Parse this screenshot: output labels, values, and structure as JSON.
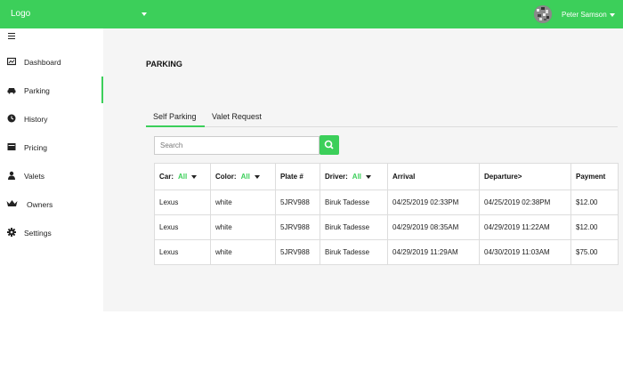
{
  "header": {
    "logo": "Logo",
    "user_name": "Peter Samson"
  },
  "sidebar": {
    "items": [
      {
        "label": "Dashboard",
        "icon": "dashboard-icon"
      },
      {
        "label": "Parking",
        "icon": "car-icon",
        "active": true
      },
      {
        "label": "History",
        "icon": "clock-icon"
      },
      {
        "label": "Pricing",
        "icon": "pricing-icon"
      },
      {
        "label": "Valets",
        "icon": "user-icon"
      },
      {
        "label": "Owners",
        "icon": "crown-icon"
      },
      {
        "label": "Settings",
        "icon": "gear-icon"
      }
    ]
  },
  "main": {
    "title": "PARKING",
    "tabs": [
      {
        "label": "Self Parking",
        "active": true
      },
      {
        "label": "Valet Request"
      }
    ],
    "search": {
      "placeholder": "Search",
      "value": ""
    }
  },
  "table": {
    "headers": {
      "car_label": "Car:",
      "car_filter": "All",
      "color_label": "Color:",
      "color_filter": "All",
      "plate": "Plate #",
      "driver_label": "Driver:",
      "driver_filter": "All",
      "arrival": "Arrival",
      "departure": "Departure>",
      "payment": "Payment"
    },
    "rows": [
      {
        "car": "Lexus",
        "color": "white",
        "plate": "5JRV988",
        "driver": "Biruk Tadesse",
        "arrival": "04/25/2019 02:33PM",
        "departure": "04/25/2019 02:38PM",
        "payment": "$12.00"
      },
      {
        "car": "Lexus",
        "color": "white",
        "plate": "5JRV988",
        "driver": "Biruk Tadesse",
        "arrival": "04/29/2019 08:35AM",
        "departure": "04/29/2019 11:22AM",
        "payment": "$12.00"
      },
      {
        "car": "Lexus",
        "color": "white",
        "plate": "5JRV988",
        "driver": "Biruk Tadesse",
        "arrival": "04/29/2019 11:29AM",
        "departure": "04/30/2019 11:03AM",
        "payment": "$75.00"
      }
    ]
  },
  "colors": {
    "accent": "#3ccf5a"
  }
}
